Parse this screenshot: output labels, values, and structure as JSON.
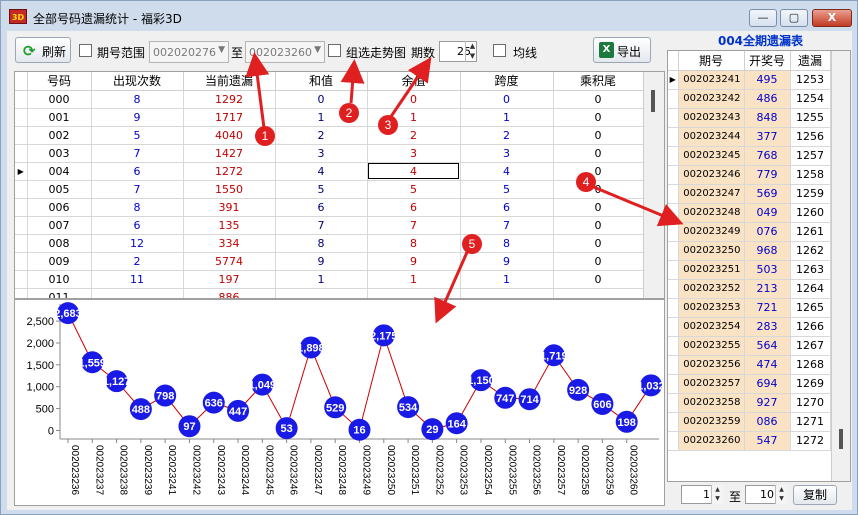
{
  "window": {
    "title": "全部号码遗漏统计 - 福彩3D",
    "icon": "3D",
    "min_label": "—",
    "max_label": "▢",
    "close_label": "X"
  },
  "toolbar": {
    "refresh_label": "刷新",
    "period_range_label": "期号范围",
    "from_value": "002020276",
    "to_label": "至",
    "to_value": "002023260",
    "group_trend_label": "组选走势图",
    "period_count_label": "期数",
    "period_count": "25",
    "average_label": "均线",
    "export_label": "导出"
  },
  "main_table": {
    "headers": [
      "号码",
      "出现次数",
      "当前遗漏",
      "和值",
      "余值",
      "跨度",
      "乘积尾"
    ],
    "rows": [
      [
        "000",
        "8",
        "1292",
        "0",
        "0",
        "0",
        "0"
      ],
      [
        "001",
        "9",
        "1717",
        "1",
        "1",
        "1",
        "0"
      ],
      [
        "002",
        "5",
        "4040",
        "2",
        "2",
        "2",
        "0"
      ],
      [
        "003",
        "7",
        "1427",
        "3",
        "3",
        "3",
        "0"
      ],
      [
        "004",
        "6",
        "1272",
        "4",
        "4",
        "4",
        "0"
      ],
      [
        "005",
        "7",
        "1550",
        "5",
        "5",
        "5",
        "0"
      ],
      [
        "006",
        "8",
        "391",
        "6",
        "6",
        "6",
        "0"
      ],
      [
        "007",
        "6",
        "135",
        "7",
        "7",
        "7",
        "0"
      ],
      [
        "008",
        "12",
        "334",
        "8",
        "8",
        "8",
        "0"
      ],
      [
        "009",
        "2",
        "5774",
        "9",
        "9",
        "9",
        "0"
      ],
      [
        "010",
        "11",
        "197",
        "1",
        "1",
        "1",
        "0"
      ],
      [
        "011",
        "",
        "886",
        "",
        "",
        "",
        ""
      ]
    ],
    "selected_row": 4
  },
  "side_panel": {
    "title": "004全期遗漏表",
    "headers": [
      "期号",
      "开奖号",
      "遗漏"
    ],
    "rows": [
      [
        "002023241",
        "495",
        "1253"
      ],
      [
        "002023242",
        "486",
        "1254"
      ],
      [
        "002023243",
        "848",
        "1255"
      ],
      [
        "002023244",
        "377",
        "1256"
      ],
      [
        "002023245",
        "768",
        "1257"
      ],
      [
        "002023246",
        "779",
        "1258"
      ],
      [
        "002023247",
        "569",
        "1259"
      ],
      [
        "002023248",
        "049",
        "1260"
      ],
      [
        "002023249",
        "076",
        "1261"
      ],
      [
        "002023250",
        "968",
        "1262"
      ],
      [
        "002023251",
        "503",
        "1263"
      ],
      [
        "002023252",
        "213",
        "1264"
      ],
      [
        "002023253",
        "721",
        "1265"
      ],
      [
        "002023254",
        "283",
        "1266"
      ],
      [
        "002023255",
        "564",
        "1267"
      ],
      [
        "002023256",
        "474",
        "1268"
      ],
      [
        "002023257",
        "694",
        "1269"
      ],
      [
        "002023258",
        "927",
        "1270"
      ],
      [
        "002023259",
        "086",
        "1271"
      ],
      [
        "002023260",
        "547",
        "1272"
      ]
    ],
    "copy_from": "1",
    "copy_to_label": "至",
    "copy_to": "10",
    "copy_label": "复制"
  },
  "chart_data": {
    "type": "line",
    "x": [
      "002023236",
      "002023237",
      "002023238",
      "002023239",
      "002023241",
      "002023242",
      "002023243",
      "002023244",
      "002023245",
      "002023246",
      "002023247",
      "002023248",
      "002023249",
      "002023250",
      "002023251",
      "002023252",
      "002023253",
      "002023254",
      "002023255",
      "002023256",
      "002023257",
      "002023258",
      "002023259",
      "002023260"
    ],
    "values": [
      2683,
      1559,
      1127,
      488,
      798,
      97,
      636,
      447,
      1049,
      53,
      1898,
      529,
      16,
      2175,
      534,
      29,
      164,
      1150,
      747,
      714,
      1719,
      928,
      606,
      198,
      1032
    ],
    "labels": [
      "2,683",
      "1,559",
      "1,127",
      "488",
      "798",
      "97",
      "636",
      "447",
      "1,049",
      "53",
      "1,898",
      "529",
      "16",
      "2,175",
      "534",
      "29",
      "164",
      "1,150",
      "747",
      "714",
      "1,719",
      "928",
      "606",
      "198",
      "1,032"
    ],
    "yticks": [
      0,
      500,
      1000,
      1500,
      2000,
      2500
    ],
    "ytick_labels": [
      "0",
      "500",
      "1,000",
      "1,500",
      "2,000",
      "2,500"
    ],
    "ylim": [
      -150,
      2800
    ],
    "grid": false,
    "line_color": "#cc0000",
    "marker_color": "#1a1ae6"
  },
  "annotations": [
    "1",
    "2",
    "3",
    "4",
    "5"
  ],
  "colors": {
    "count": "#0000cc",
    "omission": "#c00000",
    "value": "#00007a",
    "accent": "#0033cc",
    "badge": "#e02020"
  }
}
